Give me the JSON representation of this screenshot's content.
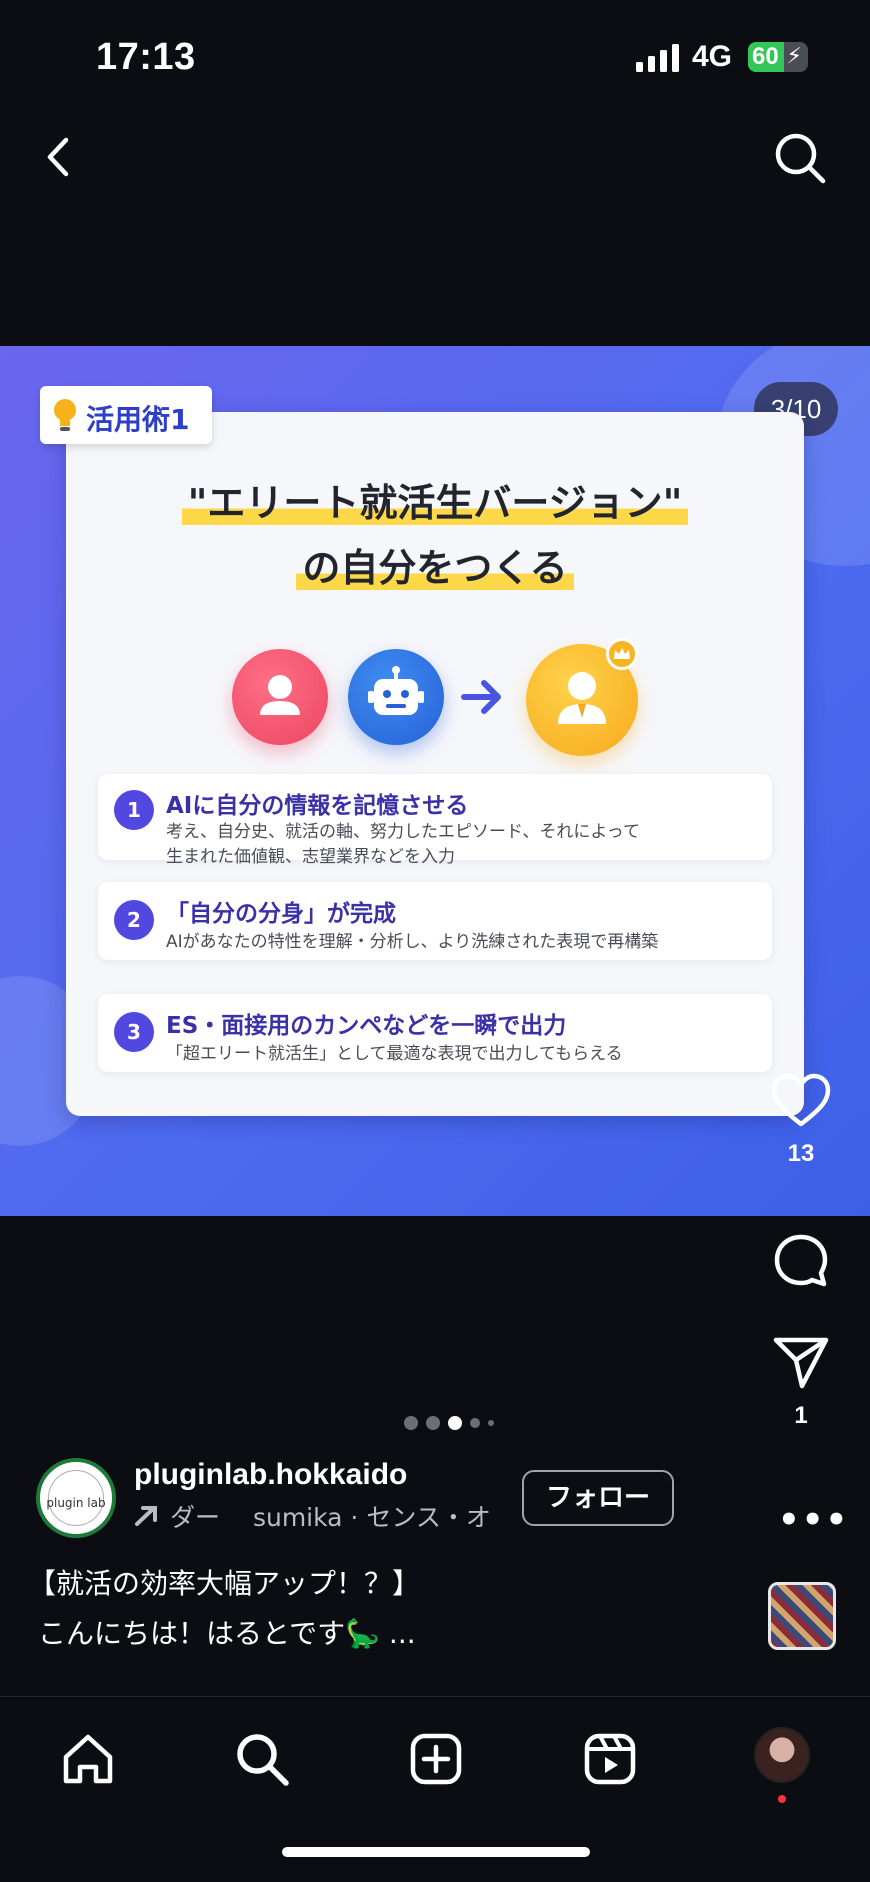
{
  "status_bar": {
    "time": "17:13",
    "network": "4G",
    "battery": "60",
    "battery_level": 0.6
  },
  "slide": {
    "counter": "3/10",
    "tag": "活用術1",
    "headline_line1": "\"エリート就活生バージョン\"",
    "headline_line2": "の自分をつくる",
    "steps": [
      {
        "num": "1",
        "title": "AIに自分の情報を記憶させる",
        "desc_line1": "考え、自分史、就活の軸、努力したエピソード、それによって",
        "desc_line2": "生まれた価値観、志望業界などを入力"
      },
      {
        "num": "2",
        "title": "「自分の分身」が完成",
        "desc_line1": "AIがあなたの特性を理解・分析し、より洗練された表現で再構築"
      },
      {
        "num": "3",
        "title": "ES・面接用のカンペなどを一瞬で出力",
        "desc_line1": "「超エリート就活生」として最適な表現で出力してもらえる"
      }
    ]
  },
  "actions": {
    "like_count": "13",
    "share_count": "1"
  },
  "carousel": {
    "total": 5,
    "active": 3
  },
  "account": {
    "username": "pluginlab.hokkaido",
    "avatar_text": "plugin lab",
    "music": "ダー　 sumika · センス・オ",
    "follow_label": "フォロー",
    "more": "•••"
  },
  "caption": {
    "line1": "【就活の効率大幅アップ！？】",
    "line2": "こんにちは！はるとです🦕 ..."
  },
  "icons": {
    "back": "chevron-left-icon",
    "search": "search-icon",
    "like": "heart-icon",
    "comment": "comment-icon",
    "share": "paper-plane-icon",
    "nav": [
      "home-icon",
      "search-icon",
      "create-icon",
      "reels-icon",
      "profile-avatar"
    ]
  },
  "colors": {
    "slide_bg": "#5266ef",
    "accent": "#5247e0",
    "highlight": "#ffd84a",
    "dark_bg": "#0b0d12"
  }
}
